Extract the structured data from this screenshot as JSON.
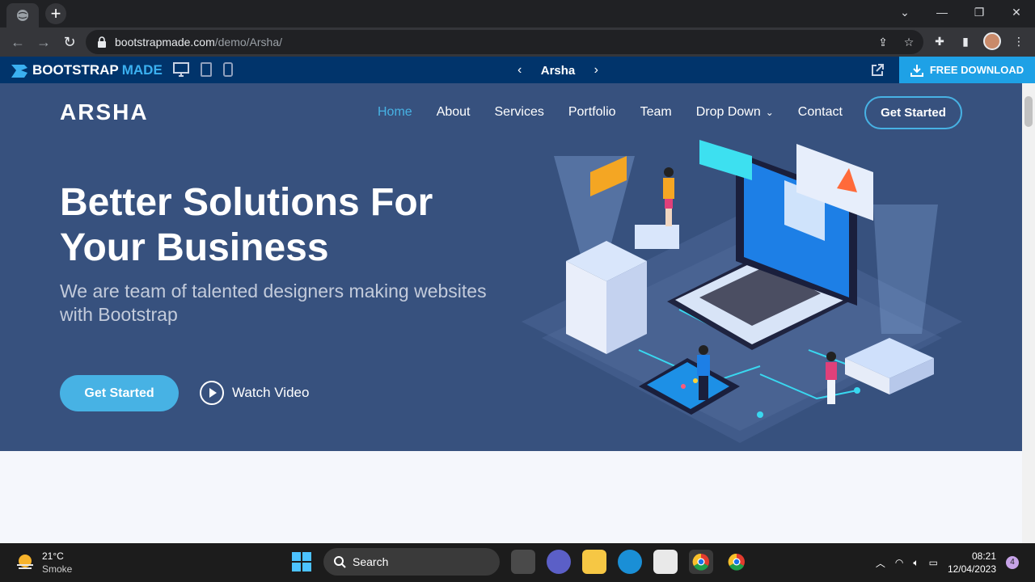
{
  "browser": {
    "url_host": "bootstrapmade.com",
    "url_path": "/demo/Arsha/"
  },
  "bm_bar": {
    "logo_main": "BOOTSTRAP",
    "logo_accent": "MADE",
    "template_name": "Arsha",
    "download_label": "FREE DOWNLOAD"
  },
  "site": {
    "brand": "ARSHA",
    "nav": [
      {
        "label": "Home"
      },
      {
        "label": "About"
      },
      {
        "label": "Services"
      },
      {
        "label": "Portfolio"
      },
      {
        "label": "Team"
      },
      {
        "label": "Drop Down"
      },
      {
        "label": "Contact"
      }
    ],
    "nav_cta": "Get Started",
    "hero_title_line1": "Better Solutions For",
    "hero_title_line2": "Your Business",
    "hero_subtitle": "We are team of talented designers making websites with Bootstrap",
    "hero_cta": "Get Started",
    "watch_video": "Watch Video"
  },
  "taskbar": {
    "temp": "21°C",
    "weather": "Smoke",
    "search": "Search",
    "time": "08:21",
    "date": "12/04/2023",
    "notifications": "4"
  },
  "colors": {
    "hero_bg": "#37517e",
    "accent": "#47b2e4",
    "bm_bar": "#01346b"
  }
}
